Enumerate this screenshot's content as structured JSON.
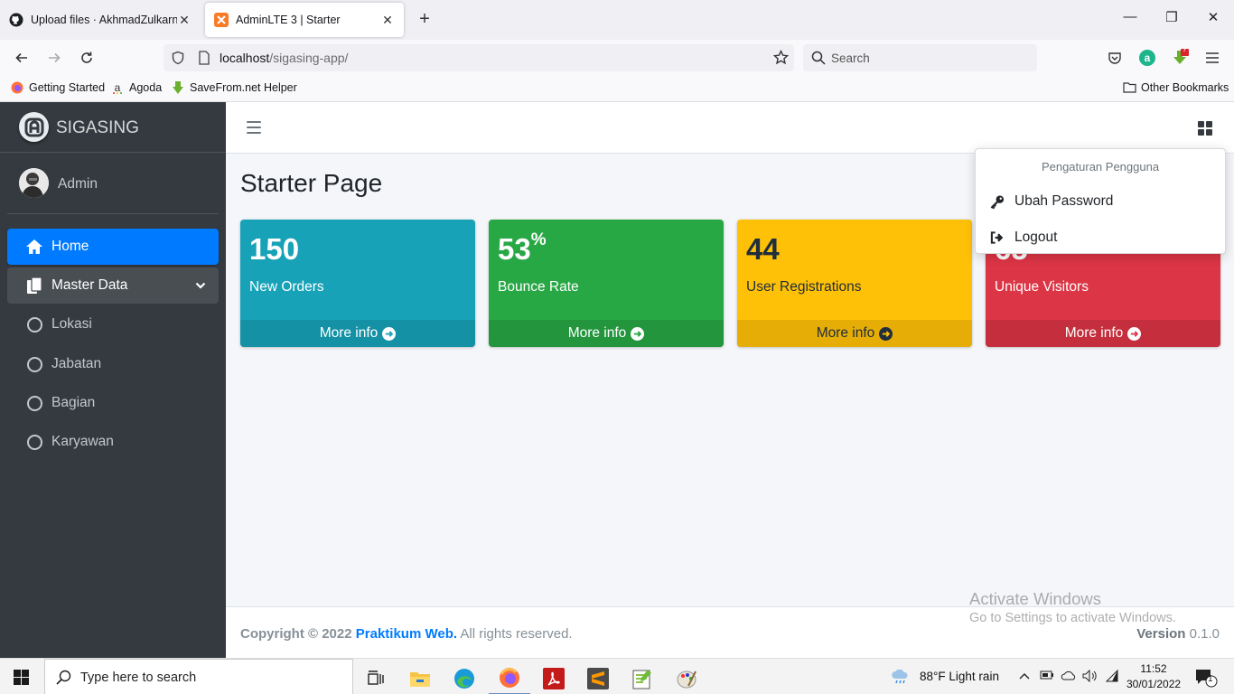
{
  "browser": {
    "tabs": [
      {
        "label": "Upload files · AkhmadZulkarnai",
        "icon": "github-icon"
      },
      {
        "label": "AdminLTE 3 | Starter",
        "icon": "xampp-icon"
      }
    ],
    "url_host": "localhost",
    "url_path": "/sigasing-app/",
    "search_placeholder": "Search",
    "addon_badge": "?",
    "bookmarks": [
      "Getting Started",
      "Agoda",
      "SaveFrom.net Helper"
    ],
    "other_bookmarks": "Other Bookmarks"
  },
  "sidebar": {
    "brand": "SIGASING",
    "user": "Admin",
    "items": [
      {
        "label": "Home",
        "icon": "home-icon",
        "state": "active"
      },
      {
        "label": "Master Data",
        "icon": "copy-icon",
        "state": "open"
      },
      {
        "label": "Lokasi",
        "icon": "circle-icon"
      },
      {
        "label": "Jabatan",
        "icon": "circle-icon"
      },
      {
        "label": "Bagian",
        "icon": "circle-icon"
      },
      {
        "label": "Karyawan",
        "icon": "circle-icon"
      }
    ]
  },
  "main": {
    "page_title": "Starter Page",
    "boxes": [
      {
        "value": "150",
        "suffix": "",
        "label": "New Orders",
        "more": "More info",
        "color": "#17a2b8"
      },
      {
        "value": "53",
        "suffix": "%",
        "label": "Bounce Rate",
        "more": "More info",
        "color": "#28a745"
      },
      {
        "value": "44",
        "suffix": "",
        "label": "User Registrations",
        "more": "More info",
        "color": "#ffc107"
      },
      {
        "value": "65",
        "suffix": "",
        "label": "Unique Visitors",
        "more": "More info",
        "color": "#dc3545"
      }
    ]
  },
  "dropdown": {
    "header": "Pengaturan Pengguna",
    "items": [
      {
        "label": "Ubah Password",
        "icon": "key-icon"
      },
      {
        "label": "Logout",
        "icon": "sign-out-icon"
      }
    ]
  },
  "footer": {
    "copyright_prefix": "Copyright © 2022",
    "link": "Praktikum Web.",
    "suffix": "All rights reserved.",
    "version_label": "Version",
    "version": "0.1.0"
  },
  "watermark": {
    "line1": "Activate Windows",
    "line2": "Go to Settings to activate Windows."
  },
  "taskbar": {
    "search_placeholder": "Type here to search",
    "weather": "88°F  Light rain",
    "time": "11:52",
    "date": "30/01/2022",
    "notifications": "1"
  }
}
